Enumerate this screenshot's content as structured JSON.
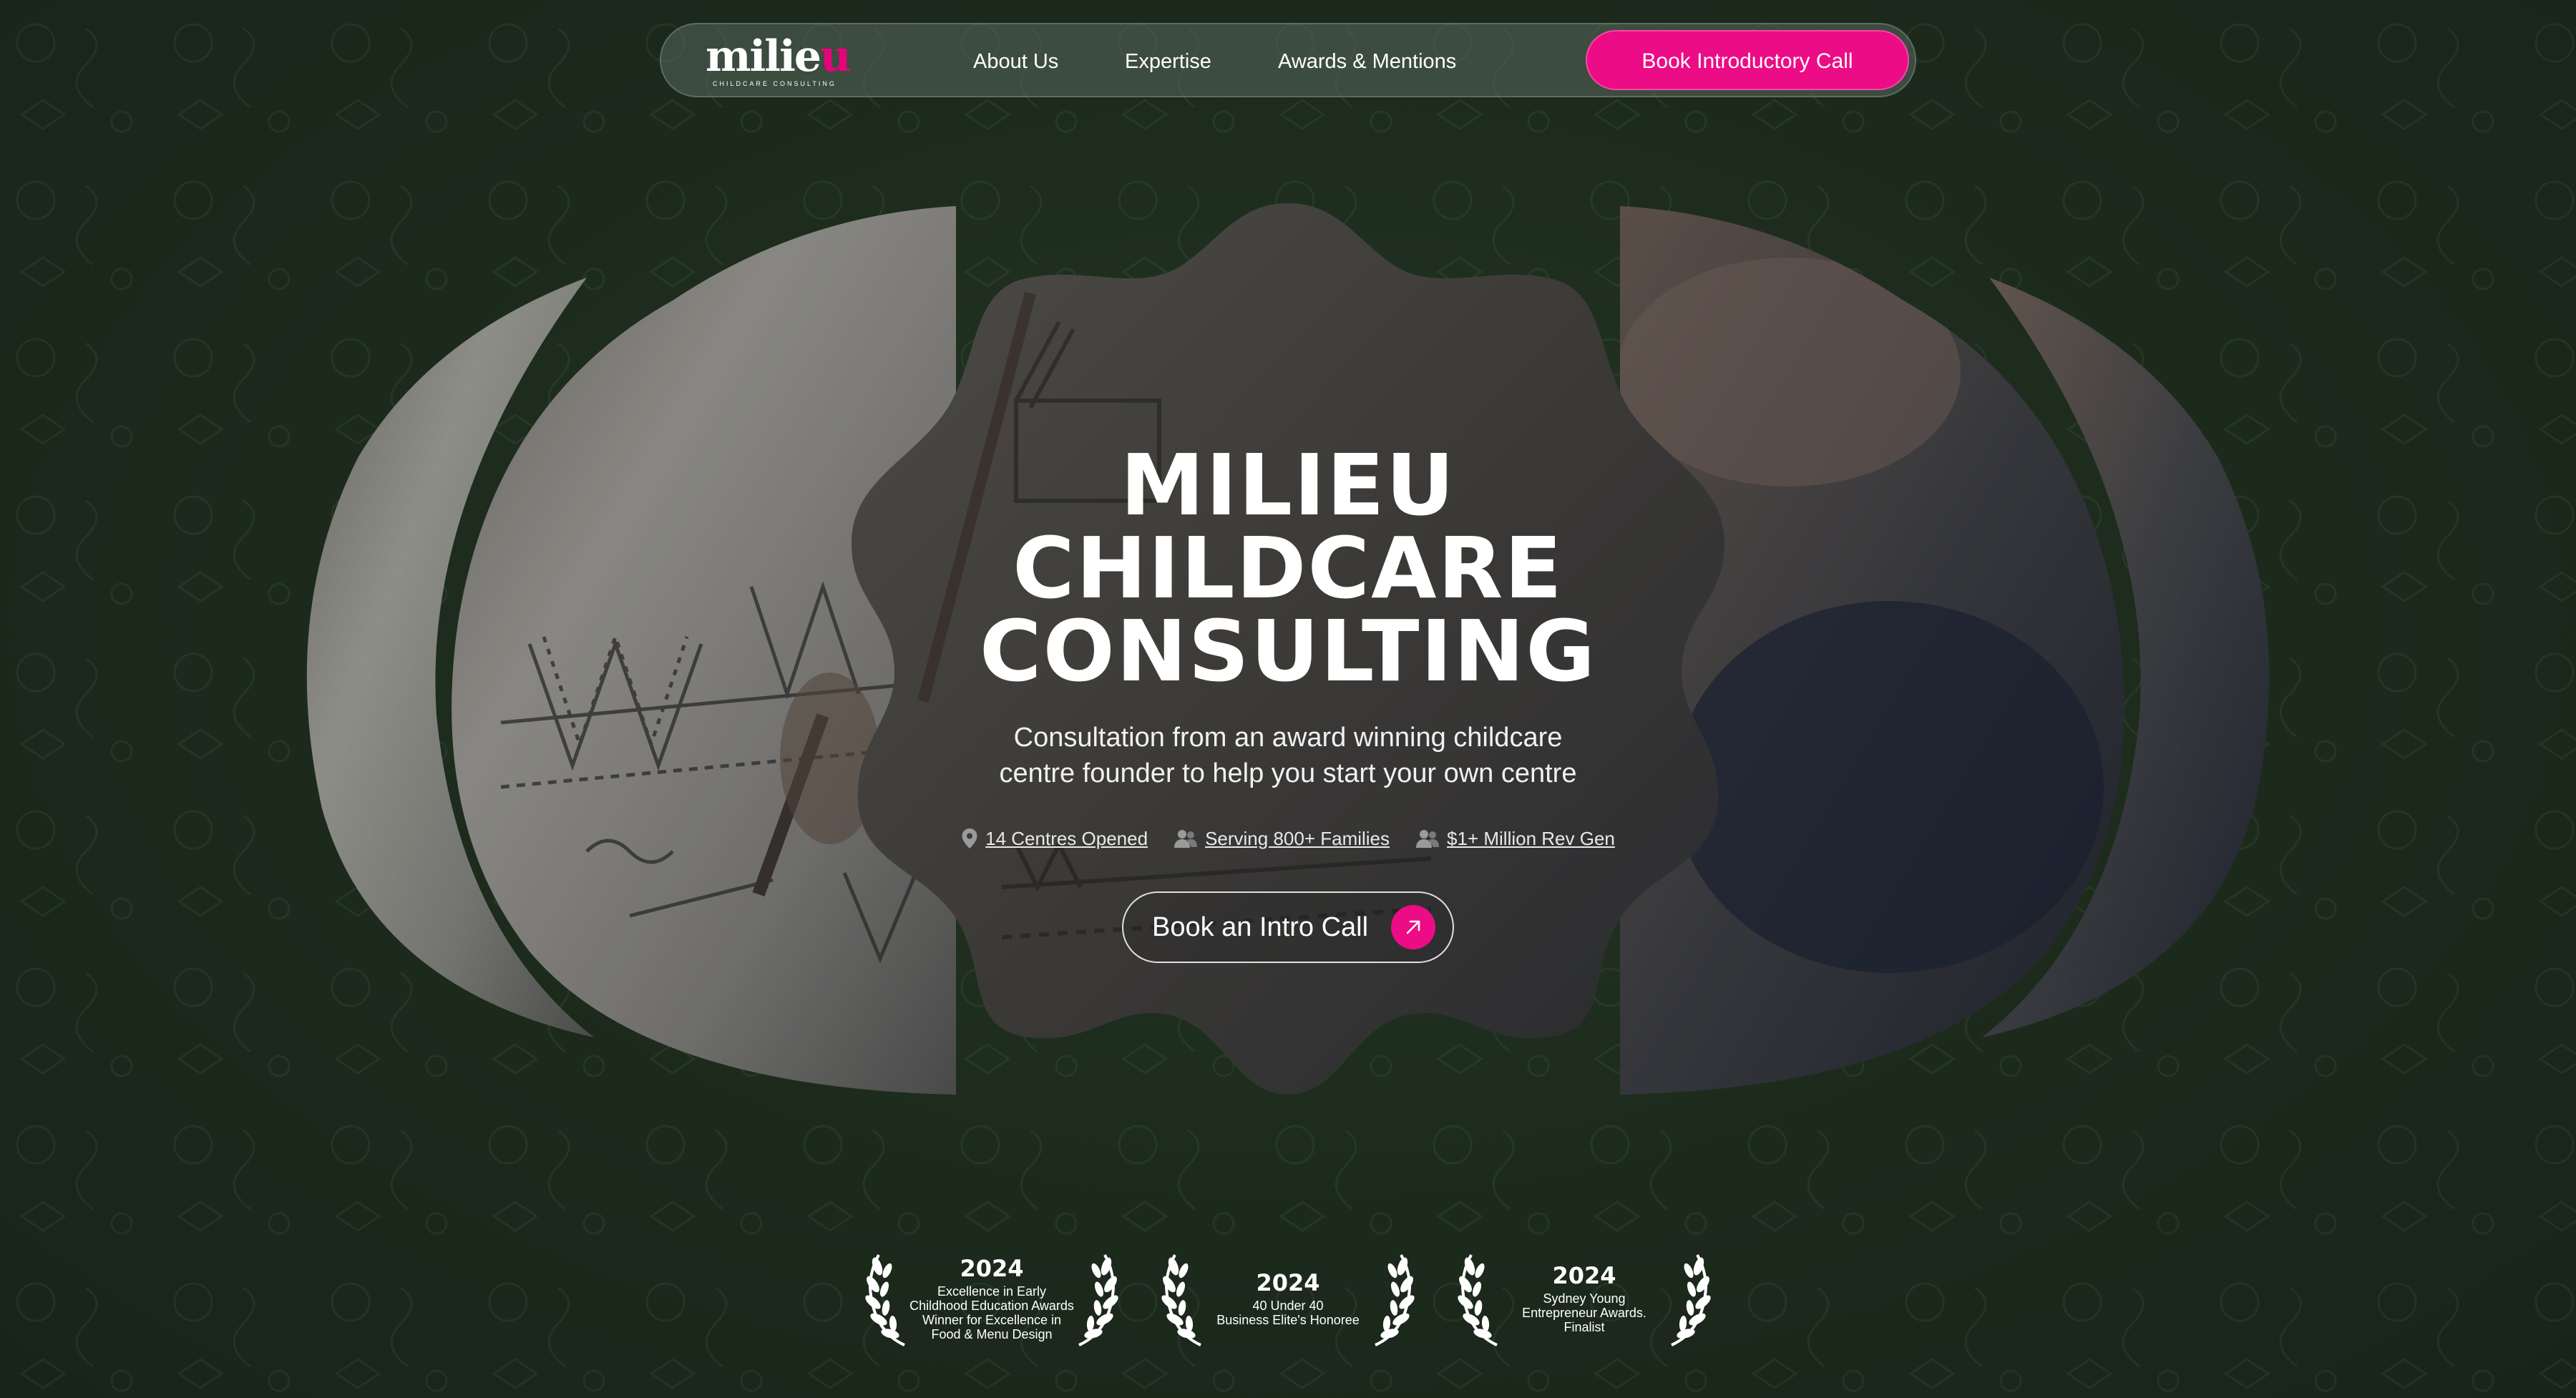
{
  "nav": {
    "logo_word_main": "milie",
    "logo_word_accent": "u",
    "logo_tagline": "CHILDCARE CONSULTING",
    "links": [
      "About Us",
      "Expertise",
      "Awards & Mentions"
    ],
    "cta_label": "Book Introductory Call"
  },
  "colors": {
    "background": "#1c2a1c",
    "accent": "#ec0c86",
    "nav_pill": "#58685c"
  },
  "hero": {
    "title_line_1": "MILIEU",
    "title_line_2": "CHILDCARE",
    "title_line_3": "CONSULTING",
    "subtitle_line_1": "Consultation from an award winning childcare",
    "subtitle_line_2": "centre founder to help you start your own centre",
    "stats": [
      {
        "icon": "location-pin-icon",
        "label": "14 Centres Opened"
      },
      {
        "icon": "users-icon",
        "label": "Serving 800+ Families"
      },
      {
        "icon": "users-icon",
        "label": "$1+ Million Rev Gen"
      }
    ],
    "cta_label": "Book an Intro Call",
    "cta_icon": "arrow-up-right-icon"
  },
  "awards": [
    {
      "year": "2024",
      "lines": [
        "Excellence in Early",
        "Childhood Education Awards",
        "Winner for Excellence in",
        "Food & Menu Design"
      ]
    },
    {
      "year": "2024",
      "lines": [
        "40 Under 40",
        "Business Elite's Honoree"
      ]
    },
    {
      "year": "2024",
      "lines": [
        "Sydney Young",
        "Entrepreneur Awards.",
        "Finalist"
      ]
    }
  ]
}
